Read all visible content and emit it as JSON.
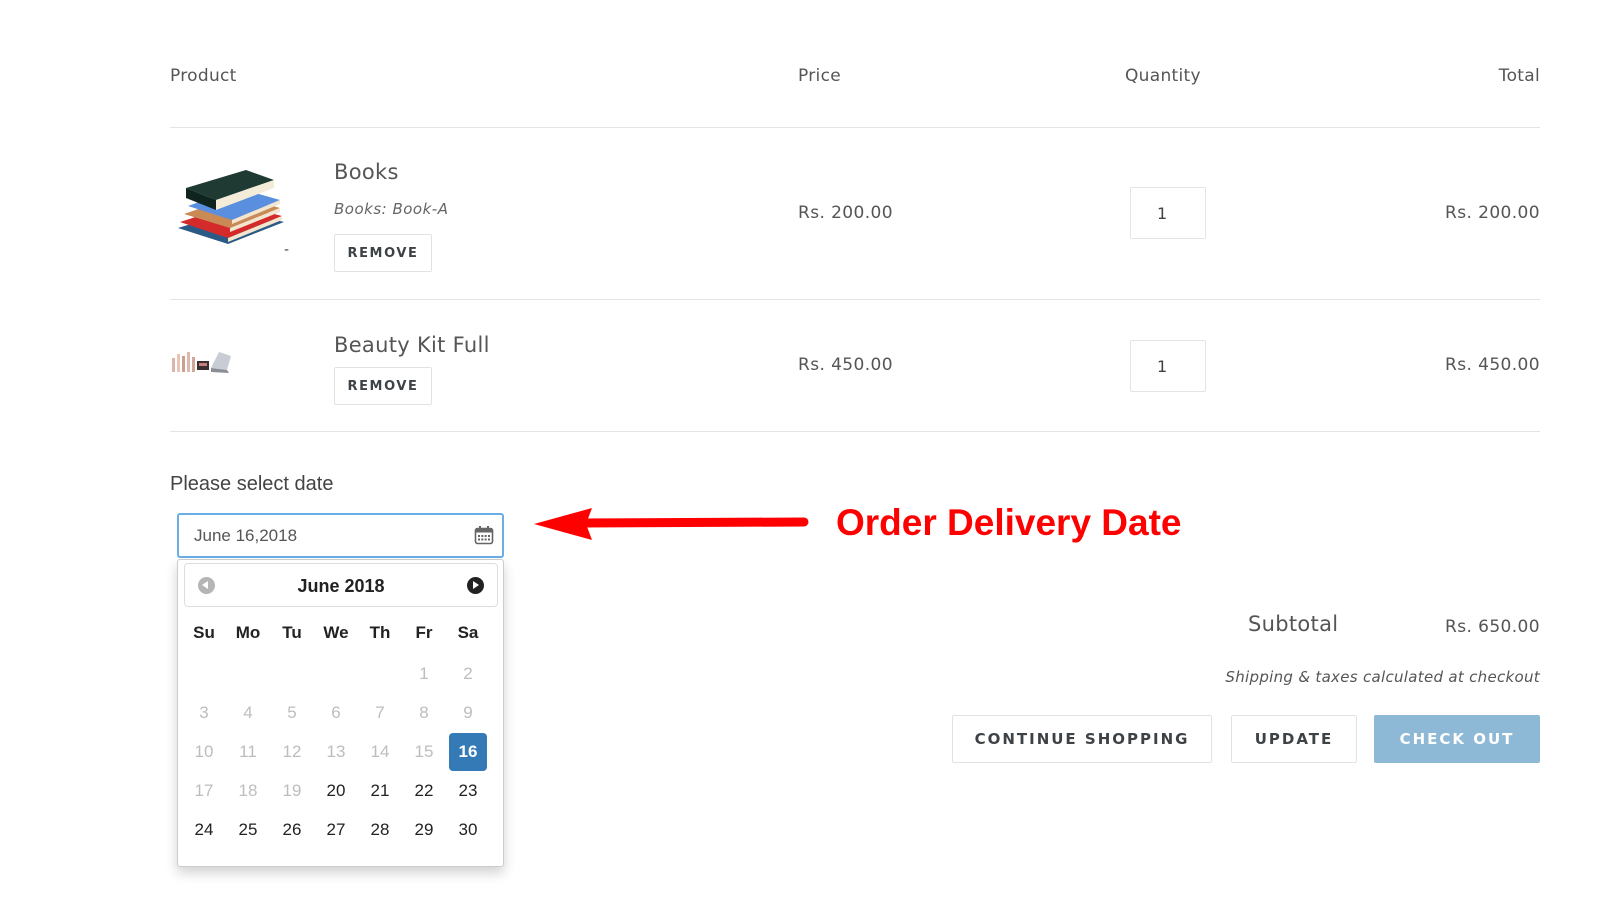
{
  "table": {
    "headers": {
      "product": "Product",
      "price": "Price",
      "quantity": "Quantity",
      "total": "Total"
    }
  },
  "items": [
    {
      "title": "Books",
      "variant": "Books: Book-A",
      "price": "Rs. 200.00",
      "quantity": "1",
      "total": "Rs. 200.00",
      "remove_label": "REMOVE",
      "image": "books-stack-image",
      "extra": "-"
    },
    {
      "title": "Beauty Kit Full",
      "price": "Rs. 450.00",
      "quantity": "1",
      "total": "Rs. 450.00",
      "remove_label": "REMOVE",
      "image": "beauty-kit-image"
    }
  ],
  "date_picker": {
    "label": "Please select date",
    "value": "June 16,2018",
    "icon": "calendar-icon",
    "month_title": "June 2018",
    "weekdays": [
      "Su",
      "Mo",
      "Tu",
      "We",
      "Th",
      "Fr",
      "Sa"
    ],
    "first_weekday_index": 5,
    "days_in_month": 30,
    "selected_day": 16,
    "min_enabled_day": 20,
    "selected_color": "#337ab7"
  },
  "annotation": {
    "text": "Order Delivery Date",
    "color": "#ff0000"
  },
  "summary": {
    "subtotal_label": "Subtotal",
    "subtotal_value": "Rs. 650.00",
    "shipping_note": "Shipping & taxes calculated at checkout"
  },
  "actions": {
    "continue_label": "CONTINUE SHOPPING",
    "update_label": "UPDATE",
    "checkout_label": "CHECK OUT",
    "checkout_color": "#8eb9d6"
  }
}
